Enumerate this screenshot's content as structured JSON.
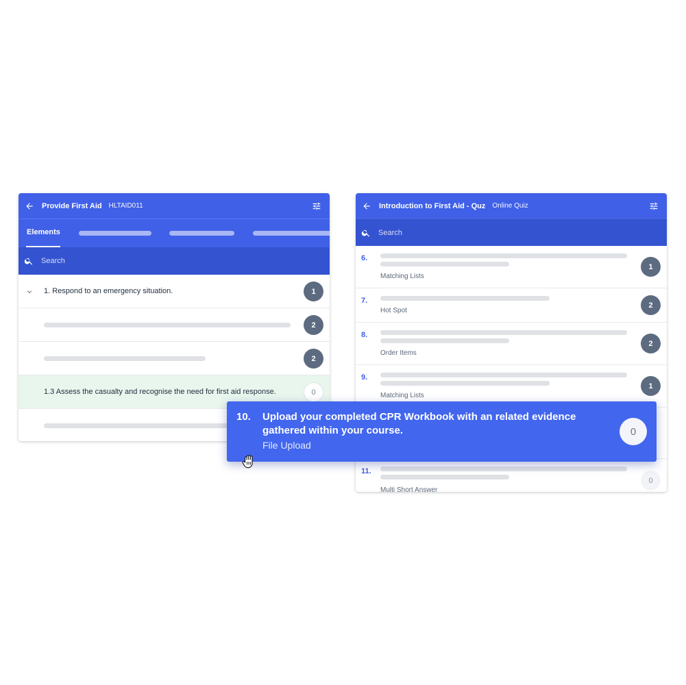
{
  "left_panel": {
    "title": "Provide First Aid",
    "code": "HLTAID011",
    "tabs": {
      "active": "Elements"
    },
    "search_placeholder": "Search",
    "rows": [
      {
        "label": "1. Respond to an emergency situation.",
        "count": "1"
      },
      {
        "label": "",
        "count": "2"
      },
      {
        "label": "",
        "count": "2"
      },
      {
        "label": "1.3 Assess the casualty and recognise the need for first aid response.",
        "count": "0"
      }
    ]
  },
  "right_panel": {
    "title": "Introduction to First Aid - Quz",
    "subtitle": "Online Quiz",
    "search_placeholder": "Search",
    "questions": [
      {
        "num": "6.",
        "type": "Matching Lists",
        "count": "1"
      },
      {
        "num": "7.",
        "type": "Hot Spot",
        "count": "2"
      },
      {
        "num": "8.",
        "type": "Order Items",
        "count": "2"
      },
      {
        "num": "9.",
        "type": "Matching Lists",
        "count": "1"
      },
      {
        "num": "11.",
        "type": "Multi Short Answer",
        "count": "0"
      }
    ]
  },
  "floating_card": {
    "num": "10.",
    "text": "Upload your completed CPR Workbook with an related evidence gathered within your course.",
    "type": "File Upload",
    "count": "0"
  },
  "colors": {
    "primary": "#4060e8",
    "search_bar": "#3453d0",
    "highlight_row": "#e8f6ee",
    "badge": "#5c6b80"
  },
  "icons": [
    "back-arrow-icon",
    "tune-icon",
    "search-icon",
    "chevron-down-icon",
    "grab-hand-icon"
  ]
}
